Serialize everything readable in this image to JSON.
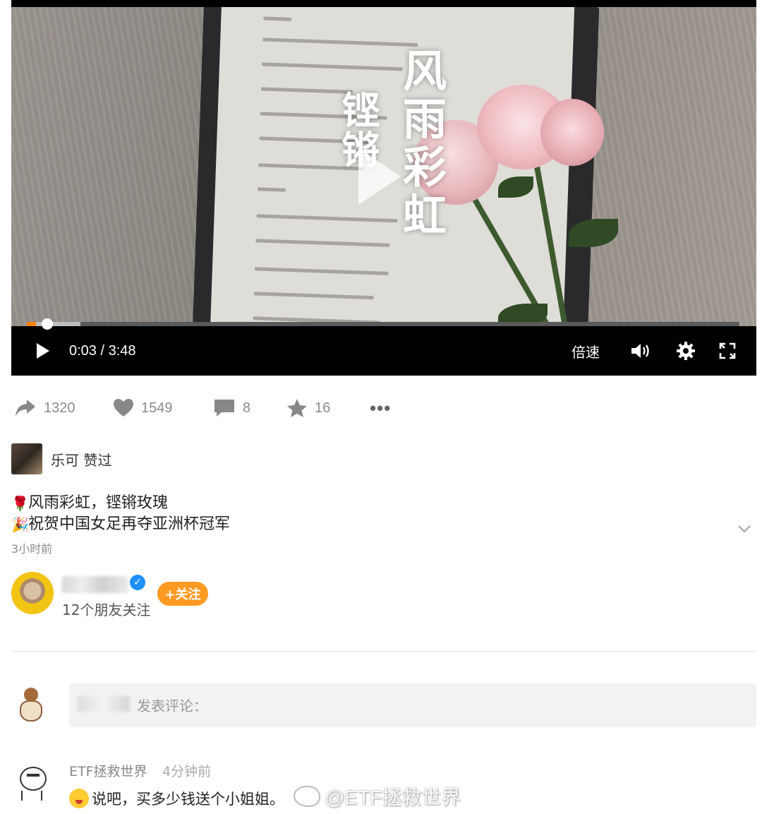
{
  "video": {
    "overlay_title_line1": "风雨彩虹",
    "overlay_title_line2": "铿锵",
    "current_time": "0:03",
    "duration": "3:48",
    "time_display": "0:03 / 3:48",
    "played_fraction": 0.013,
    "buffered_fraction": 0.075,
    "speed_label": "倍速",
    "icons": {
      "play": "play-icon",
      "volume": "volume-icon",
      "settings": "gear-icon",
      "fullscreen": "fullscreen-icon",
      "big_play": "big-play-icon"
    }
  },
  "actions": {
    "repost_count": "1320",
    "like_count": "1549",
    "comment_count": "8",
    "favorite_count": "16",
    "icons": [
      "share-icon",
      "heart-icon",
      "comment-icon",
      "star-icon",
      "more-icon"
    ]
  },
  "liked_by": {
    "text": "乐可 赞过"
  },
  "post": {
    "line1_emoji": "🌹",
    "line1": "风雨彩虹，铿锵玫瑰",
    "line2_emoji": "🎉",
    "line2": "祝贺中国女足再夺亚洲杯冠军",
    "age": "3小时前"
  },
  "author": {
    "followers_text": "12个朋友关注",
    "follow_label": "+关注"
  },
  "comment_input": {
    "placeholder": "发表评论："
  },
  "comments": [
    {
      "user": "ETF拯救世界",
      "time": "4分钟前",
      "text": "说吧，买多少钱送个小姐姐。"
    }
  ],
  "watermark": {
    "text": "@ETF拯救世界"
  },
  "colors": {
    "accent_orange": "#ff8200",
    "follow_button": "#ff9a22",
    "verified_blue": "#1e90ff"
  }
}
